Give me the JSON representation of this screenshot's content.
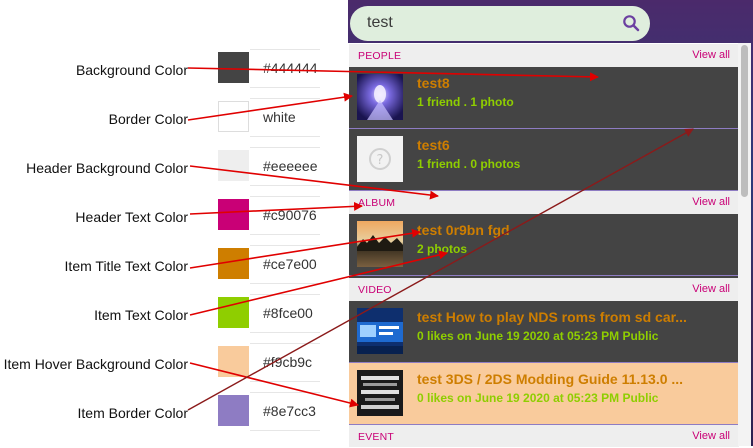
{
  "legend": [
    {
      "label": "Background Color",
      "value": "#444444",
      "swatch": "#444444"
    },
    {
      "label": "Border Color",
      "value": "white",
      "swatch": "#ffffff"
    },
    {
      "label": "Header Background Color",
      "value": "#eeeeee",
      "swatch": "#eeeeee"
    },
    {
      "label": "Header Text Color",
      "value": "#c90076",
      "swatch": "#c90076"
    },
    {
      "label": "Item Title Text Color",
      "value": "#ce7e00",
      "swatch": "#ce7e00"
    },
    {
      "label": "Item Text Color",
      "value": "#8fce00",
      "swatch": "#8fce00"
    },
    {
      "label": "Item Hover Background Color",
      "value": "#f9cb9c",
      "swatch": "#f9cb9c"
    },
    {
      "label": "Item Border Color",
      "value": "#8e7cc3",
      "swatch": "#8e7cc3"
    }
  ],
  "search": {
    "value": "test",
    "icon": "search-icon"
  },
  "dropdown": {
    "sections": [
      {
        "title": "PEOPLE",
        "view_all": "View all"
      },
      {
        "title": "ALBUM",
        "view_all": "View all"
      },
      {
        "title": "VIDEO",
        "view_all": "View all"
      },
      {
        "title": "EVENT",
        "view_all": "View all"
      }
    ],
    "people": [
      {
        "title": "test8",
        "text": "1 friend . 1 photo"
      },
      {
        "title": "test6",
        "text": "1 friend . 0 photos"
      }
    ],
    "albums": [
      {
        "title": "test 0r9bn fgd",
        "text": "2 photos"
      }
    ],
    "videos": [
      {
        "title": "test How to play NDS roms from sd car...",
        "text": "0 likes on June 19 2020 at 05:23 PM Public"
      },
      {
        "title": "test 3DS / 2DS Modding Guide 11.13.0 ...",
        "text": "0 likes on June 19 2020 at 05:23 PM Public",
        "hover": true
      }
    ]
  },
  "colors": {
    "background": "#444444",
    "border": "#ffffff",
    "header_bg": "#eeeeee",
    "header_text": "#c90076",
    "item_title": "#ce7e00",
    "item_text": "#8fce00",
    "item_hover_bg": "#f9cb9c",
    "item_border": "#8e7cc3",
    "arrow": "#e00000",
    "arrow_dark": "#8b1a1a"
  }
}
